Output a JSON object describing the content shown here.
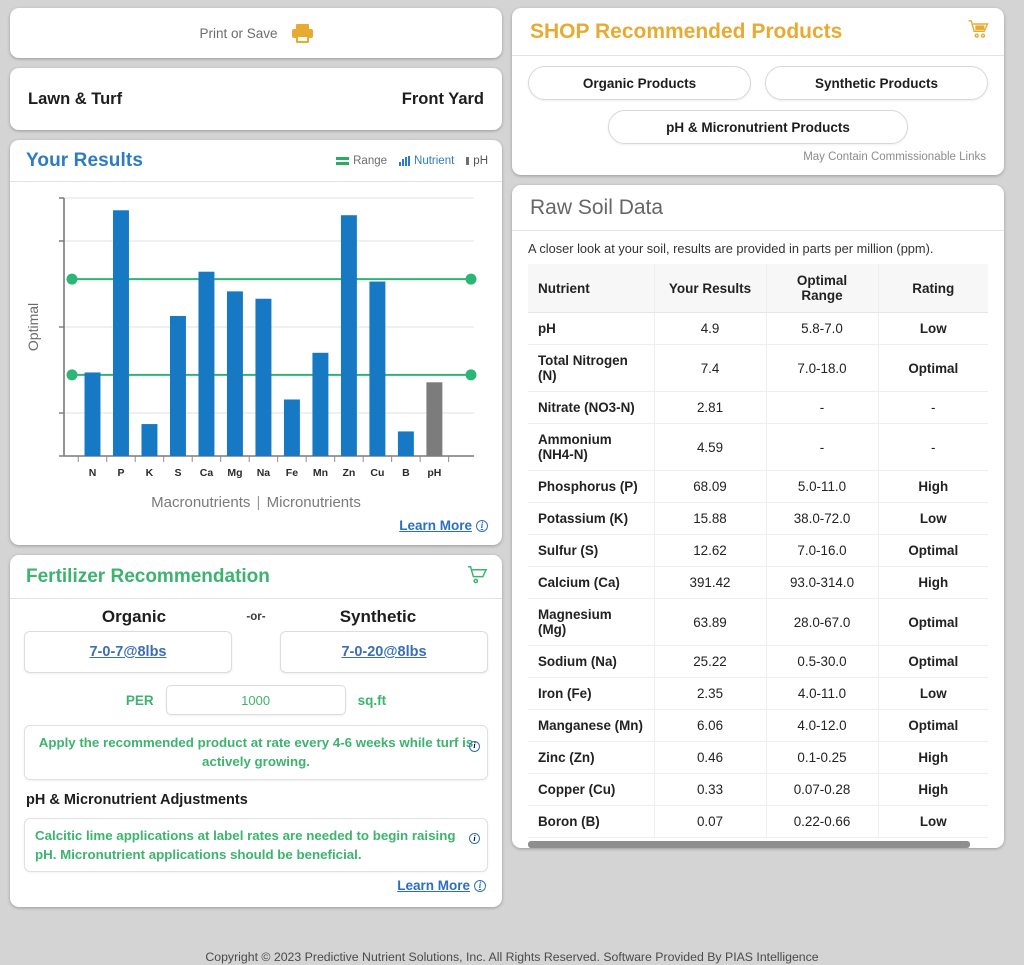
{
  "print_bar": {
    "label": "Print or Save",
    "icon": "printer-icon"
  },
  "sample": {
    "crop": "Lawn & Turf",
    "location": "Front Yard"
  },
  "results": {
    "title": "Your Results",
    "legend": [
      {
        "label": "Range",
        "icon": "range-lines-icon"
      },
      {
        "label": "Nutrient",
        "icon": "bar-chart-icon"
      },
      {
        "label": "pH",
        "icon": "ph-bar-icon"
      }
    ],
    "y_axis_label": "Optimal",
    "band_macro": "Macronutrients",
    "band_sep": "|",
    "band_micro": "Micronutrients",
    "learn_more": "Learn More",
    "colors": {
      "nutrient_bar": "#1779c4",
      "ph_bar": "#7c7c7c",
      "range_line": "#2bb673"
    }
  },
  "chart_data": {
    "type": "bar",
    "title": "Your Results",
    "xlabel": "Macronutrients | Micronutrients",
    "ylabel": "Optimal",
    "categories": [
      "N",
      "P",
      "K",
      "S",
      "Ca",
      "Mg",
      "Na",
      "Fe",
      "Mn",
      "Zn",
      "Cu",
      "B",
      "pH"
    ],
    "values": [
      34,
      100,
      13,
      57,
      75,
      67,
      64,
      23,
      42,
      98,
      71,
      10,
      30
    ],
    "bar_colors": [
      "#1779c4",
      "#1779c4",
      "#1779c4",
      "#1779c4",
      "#1779c4",
      "#1779c4",
      "#1779c4",
      "#1779c4",
      "#1779c4",
      "#1779c4",
      "#1779c4",
      "#1779c4",
      "#7c7c7c"
    ],
    "ylim": [
      0,
      105
    ],
    "grid": true,
    "gridlines": [
      0,
      17.5,
      52.5,
      87.5,
      105
    ],
    "reference_lines": [
      {
        "name": "Optimal lower bound",
        "value": 33,
        "color": "#2bb673",
        "endpoint_marker": "circle"
      },
      {
        "name": "Optimal upper bound",
        "value": 72,
        "color": "#2bb673",
        "endpoint_marker": "circle"
      }
    ],
    "legend": [
      "Range",
      "Nutrient",
      "pH"
    ],
    "legend_position": "top-right"
  },
  "fertilizer": {
    "title": "Fertilizer Recommendation",
    "cart_icon": "cart-icon",
    "organic_label": "Organic",
    "or_label": "-or-",
    "synthetic_label": "Synthetic",
    "organic_product": "7-0-7@8lbs",
    "synthetic_product": "7-0-20@8lbs",
    "per_label": "PER",
    "per_value": "1000",
    "per_unit": "sq.ft",
    "application_note": "Apply the recommended product at rate every 4-6 weeks while turf is actively growing.",
    "adjust_heading": "pH & Micronutrient Adjustments",
    "adjust_note": "Calcitic lime applications at label rates are needed to begin raising pH. Micronutrient applications should be beneficial.",
    "learn_more": "Learn More"
  },
  "shop": {
    "title": "SHOP Recommended Products",
    "cart_icon": "cart-icon",
    "buttons": [
      {
        "label": "Organic Products"
      },
      {
        "label": "Synthetic Products"
      },
      {
        "label": "pH & Micronutrient Products"
      }
    ],
    "disclaimer": "May Contain Commissionable Links",
    "accent": "#e8ab31"
  },
  "raw_soil": {
    "title": "Raw Soil Data",
    "subtitle": "A closer look at your soil, results are provided in parts per million (ppm).",
    "columns": [
      "Nutrient",
      "Your Results",
      "Optimal Range",
      "Rating"
    ],
    "rows": [
      {
        "nutrient": "pH",
        "result": "4.9",
        "range": "5.8-7.0",
        "rating": "Low",
        "rating_class": "r-low"
      },
      {
        "nutrient": "Total Nitrogen (N)",
        "result": "7.4",
        "range": "7.0-18.0",
        "rating": "Optimal",
        "rating_class": "r-opt"
      },
      {
        "nutrient": "Nitrate (NO3-N)",
        "result": "2.81",
        "range": "-",
        "rating": "-",
        "rating_class": "r-dash"
      },
      {
        "nutrient": "Ammonium (NH4-N)",
        "result": "4.59",
        "range": "-",
        "rating": "-",
        "rating_class": "r-dash"
      },
      {
        "nutrient": "Phosphorus (P)",
        "result": "68.09",
        "range": "5.0-11.0",
        "rating": "High",
        "rating_class": "r-high"
      },
      {
        "nutrient": "Potassium (K)",
        "result": "15.88",
        "range": "38.0-72.0",
        "rating": "Low",
        "rating_class": "r-low"
      },
      {
        "nutrient": "Sulfur (S)",
        "result": "12.62",
        "range": "7.0-16.0",
        "rating": "Optimal",
        "rating_class": "r-opt"
      },
      {
        "nutrient": "Calcium (Ca)",
        "result": "391.42",
        "range": "93.0-314.0",
        "rating": "High",
        "rating_class": "r-high"
      },
      {
        "nutrient": "Magnesium (Mg)",
        "result": "63.89",
        "range": "28.0-67.0",
        "rating": "Optimal",
        "rating_class": "r-opt"
      },
      {
        "nutrient": "Sodium (Na)",
        "result": "25.22",
        "range": "0.5-30.0",
        "rating": "Optimal",
        "rating_class": "r-opt"
      },
      {
        "nutrient": "Iron (Fe)",
        "result": "2.35",
        "range": "4.0-11.0",
        "rating": "Low",
        "rating_class": "r-low"
      },
      {
        "nutrient": "Manganese (Mn)",
        "result": "6.06",
        "range": "4.0-12.0",
        "rating": "Optimal",
        "rating_class": "r-opt"
      },
      {
        "nutrient": "Zinc (Zn)",
        "result": "0.46",
        "range": "0.1-0.25",
        "rating": "High",
        "rating_class": "r-high"
      },
      {
        "nutrient": "Copper (Cu)",
        "result": "0.33",
        "range": "0.07-0.28",
        "rating": "High",
        "rating_class": "r-high"
      },
      {
        "nutrient": "Boron (B)",
        "result": "0.07",
        "range": "0.22-0.66",
        "rating": "Low",
        "rating_class": "r-low"
      }
    ]
  },
  "footer": {
    "text": "Copyright © 2023 Predictive Nutrient Solutions, Inc. All Rights Reserved. Software Provided By PIAS Intelligence"
  }
}
